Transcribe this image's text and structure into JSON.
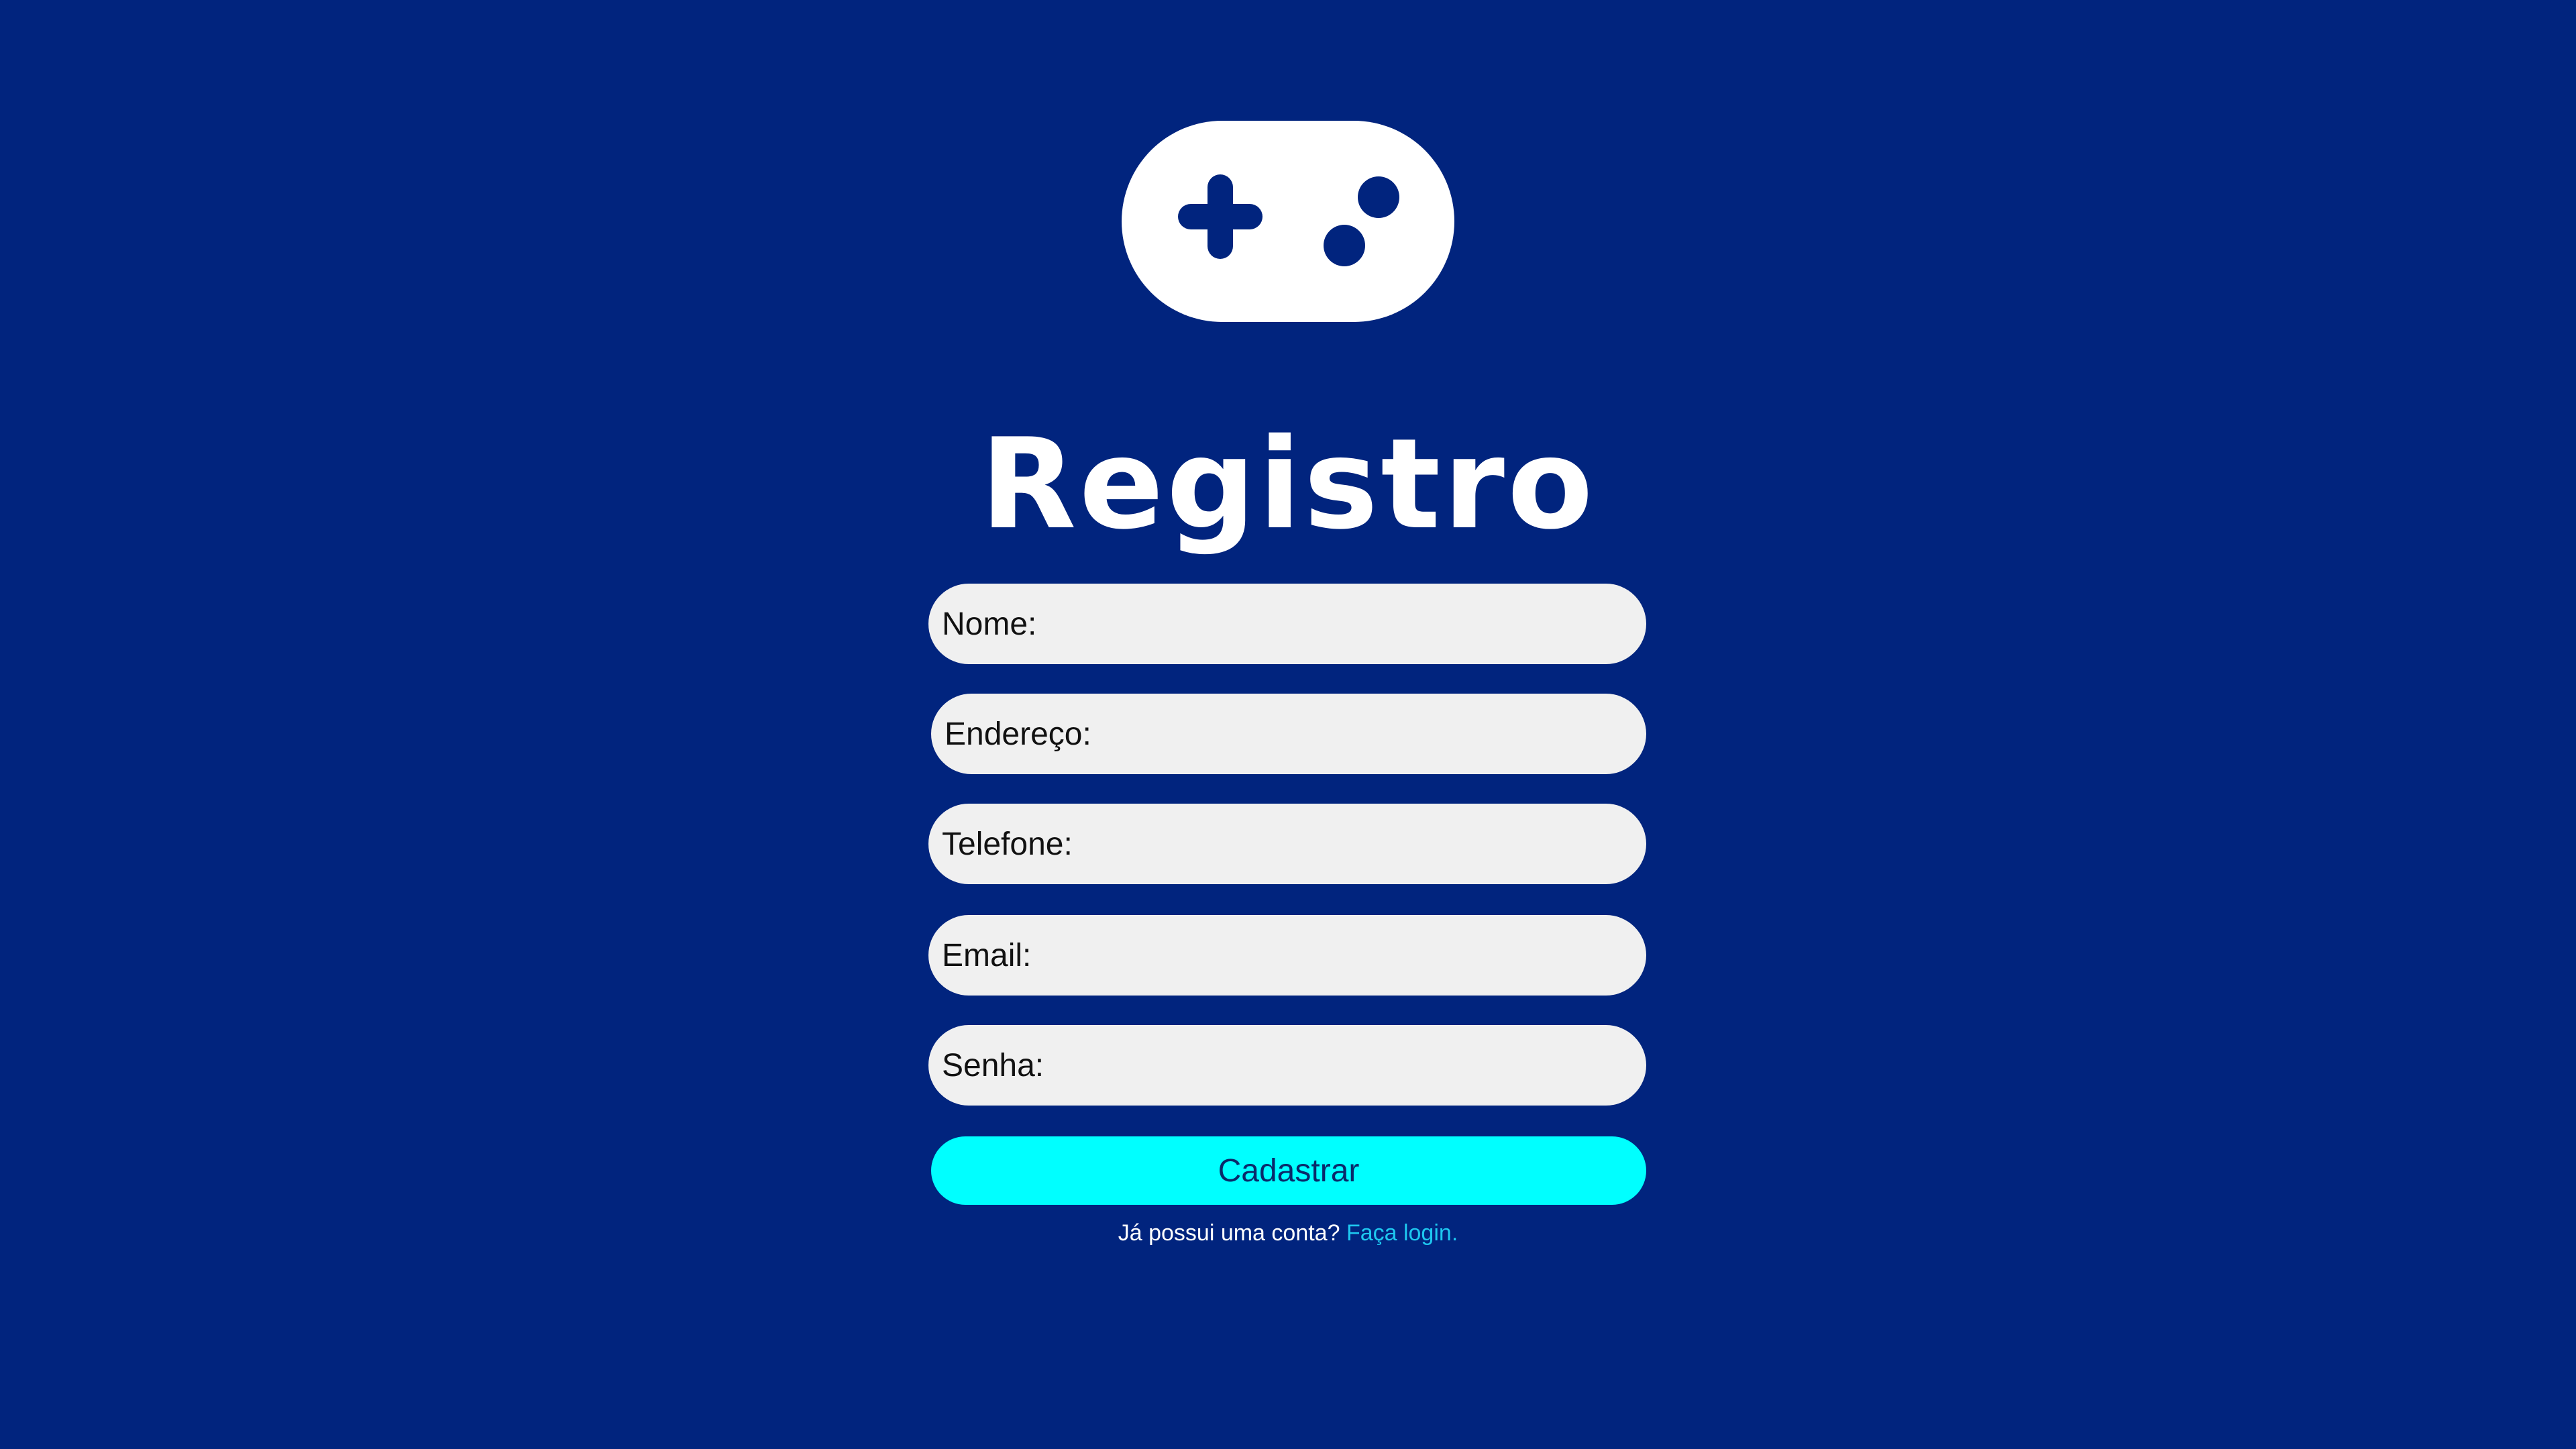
{
  "colors": {
    "background": "#01247e",
    "field_background": "#f0f0f0",
    "button_background": "#00ffff",
    "link": "#1ec8f0"
  },
  "logo": {
    "icon": "gamepad-icon"
  },
  "title": "Registro",
  "form": {
    "fields": [
      {
        "name": "nome",
        "placeholder": "Nome:",
        "value": ""
      },
      {
        "name": "endereco",
        "placeholder": "Endereço:",
        "value": ""
      },
      {
        "name": "telefone",
        "placeholder": "Telefone:",
        "value": ""
      },
      {
        "name": "email",
        "placeholder": "Email:",
        "value": ""
      },
      {
        "name": "senha",
        "placeholder": "Senha:",
        "value": ""
      }
    ],
    "submit_label": "Cadastrar"
  },
  "login_prompt": {
    "text": "Já possui uma conta? ",
    "link_text": "Faça login",
    "suffix": "."
  }
}
